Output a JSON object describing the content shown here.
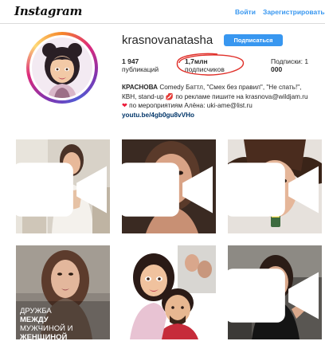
{
  "header": {
    "logo": "Instagram",
    "login": "Войти",
    "register": "Зарегистрироваться"
  },
  "profile": {
    "username": "krasnovanatasha",
    "follow_label": "Подписаться",
    "stats": {
      "posts_count": "1 947",
      "posts_label": "публикаций",
      "followers_count": "1,7млн",
      "followers_label": "подписчиков",
      "following_label": "Подписки: 1",
      "following_count": "000"
    },
    "bio": {
      "name": "КРАСНОВА",
      "line1_rest": " Comedy Баттл, \"Смех без правил\", \"Не спать!\",",
      "line2_start": "КВН, stand-up ",
      "line2_rest": " по рекламе пишите на krasnova@wildjam.ru",
      "line3_rest": " по мероприятиям Алёна: uki-ame@list.ru",
      "link": "youtu.be/4gb0gu8vVHo"
    }
  },
  "posts": [
    {
      "type": "video",
      "caption": ""
    },
    {
      "type": "video",
      "caption": ""
    },
    {
      "type": "video",
      "caption": ""
    },
    {
      "type": "image",
      "caption": [
        "ДРУЖБА",
        "МЕЖДУ",
        "МУЖЧИНОЙ И",
        "ЖЕНЩИНОЙ"
      ]
    },
    {
      "type": "image",
      "caption": ""
    },
    {
      "type": "video",
      "caption": ""
    }
  ],
  "colors": {
    "accent": "#3897f0",
    "annotation": "#e0302a",
    "link": "#003569"
  }
}
